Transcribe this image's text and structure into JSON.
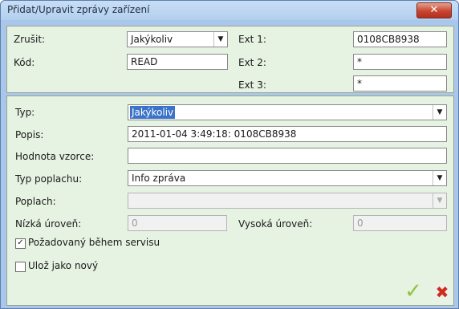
{
  "window": {
    "title": "Přidat/Upravit zprávy zařízení",
    "close_glyph": "✕"
  },
  "top": {
    "zrusit_label": "Zrušit:",
    "zrusit_value": "Jakýkoliv",
    "kod_label": "Kód:",
    "kod_value": "READ",
    "ext1_label": "Ext 1:",
    "ext1_value": "0108CB8938",
    "ext2_label": "Ext 2:",
    "ext2_value": "*",
    "ext3_label": "Ext 3:",
    "ext3_value": "*"
  },
  "bottom": {
    "typ_label": "Typ:",
    "typ_value": "Jakýkoliv",
    "popis_label": "Popis:",
    "popis_value": "2011-01-04 3:49:18: 0108CB8938",
    "hodnota_label": "Hodnota vzorce:",
    "hodnota_value": "",
    "typ_poplachu_label": "Typ poplachu:",
    "typ_poplachu_value": "Info zpráva",
    "poplach_label": "Poplach:",
    "poplach_value": "",
    "nizka_label": "Nízká úroveň:",
    "nizka_value": "0",
    "vysoka_label": "Vysoká úroveň:",
    "vysoka_value": "0",
    "servis_label": "Požadovaný během servisu",
    "servis_checked": true,
    "uloz_label": "Ulož jako nový",
    "uloz_checked": false
  },
  "icons": {
    "dropdown": "▼",
    "check": "✓",
    "ok": "✓",
    "cancel": "✖"
  },
  "colors": {
    "window_bg": "#a9c7ea",
    "panel_bg": "#e6f2e2",
    "close_red": "#c8452f",
    "ok_green": "#8cc63a",
    "cancel_red": "#d12a1f",
    "selection_blue": "#3a73c9"
  }
}
